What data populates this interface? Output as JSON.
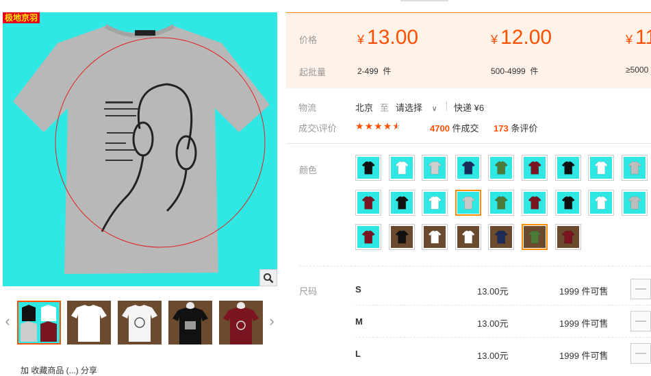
{
  "gallery": {
    "brand_tag": "极地京羽",
    "bottom_text": "加 收藏商品 (...) 分享",
    "thumbs": [
      "thumb-1",
      "thumb-2",
      "thumb-3",
      "thumb-4",
      "thumb-5"
    ]
  },
  "price_panel": {
    "price_label": "价格",
    "moq_label": "起批量",
    "currency": "¥",
    "tiers": [
      {
        "price": "13.00",
        "qty": "2-499",
        "unit": "件"
      },
      {
        "price": "12.00",
        "qty": "500-4999",
        "unit": "件"
      },
      {
        "price": "11",
        "qty": "≥5000",
        "unit": ""
      }
    ]
  },
  "logistics": {
    "label": "物流",
    "from": "北京",
    "to_word": "至",
    "select": "请选择",
    "express": "快递 ¥6"
  },
  "deals": {
    "label": "成交\\评价",
    "rating": 4.5,
    "sold_count": "4700",
    "sold_suffix": "件成交",
    "review_count": "173",
    "review_suffix": "条评价"
  },
  "color": {
    "label": "颜色",
    "swatches": [
      {
        "bg": "#2fe8e3",
        "shirt": "#111111"
      },
      {
        "bg": "#2fe8e3",
        "shirt": "#ffffff"
      },
      {
        "bg": "#2fe8e3",
        "shirt": "#cfcfcf"
      },
      {
        "bg": "#2fe8e3",
        "shirt": "#1b2b5a"
      },
      {
        "bg": "#2fe8e3",
        "shirt": "#4e7a3a"
      },
      {
        "bg": "#2fe8e3",
        "shirt": "#7a1420"
      },
      {
        "bg": "#2fe8e3",
        "shirt": "#111111"
      },
      {
        "bg": "#2fe8e3",
        "shirt": "#ffffff"
      },
      {
        "bg": "#2fe8e3",
        "shirt": "#bdbdbd"
      },
      {
        "bg": "#2fe8e3",
        "shirt": "#7a1420"
      },
      {
        "bg": "#2fe8e3",
        "shirt": "#111111"
      },
      {
        "bg": "#2fe8e3",
        "shirt": "#ffffff"
      },
      {
        "bg": "#2fe8e3",
        "shirt": "#c8c8c8",
        "selected": true
      },
      {
        "bg": "#2fe8e3",
        "shirt": "#4e7a3a"
      },
      {
        "bg": "#2fe8e3",
        "shirt": "#7a1420"
      },
      {
        "bg": "#2fe8e3",
        "shirt": "#111111"
      },
      {
        "bg": "#2fe8e3",
        "shirt": "#ffffff"
      },
      {
        "bg": "#2fe8e3",
        "shirt": "#bdbdbd"
      },
      {
        "bg": "#2fe8e3",
        "shirt": "#7a1420"
      },
      {
        "bg": "#6b4a2e",
        "shirt": "#111111"
      },
      {
        "bg": "#6b4a2e",
        "shirt": "#ffffff"
      },
      {
        "bg": "#6b4a2e",
        "shirt": "#ffffff"
      },
      {
        "bg": "#6b4a2e",
        "shirt": "#1b2b5a"
      },
      {
        "bg": "#6b4a2e",
        "shirt": "#4e7a3a",
        "selected": true
      },
      {
        "bg": "#6b4a2e",
        "shirt": "#7a1420"
      }
    ]
  },
  "sizes": {
    "label": "尺码",
    "rows": [
      {
        "size": "S",
        "price": "13.00元",
        "stock": "1999 件可售"
      },
      {
        "size": "M",
        "price": "13.00元",
        "stock": "1999 件可售"
      },
      {
        "size": "L",
        "price": "13.00元",
        "stock": "1999 件可售"
      }
    ],
    "minus": "—"
  },
  "colors": {
    "accent": "#ff5000",
    "panel_bg": "#fff2e8",
    "image_bg": "#2fe8e3"
  }
}
